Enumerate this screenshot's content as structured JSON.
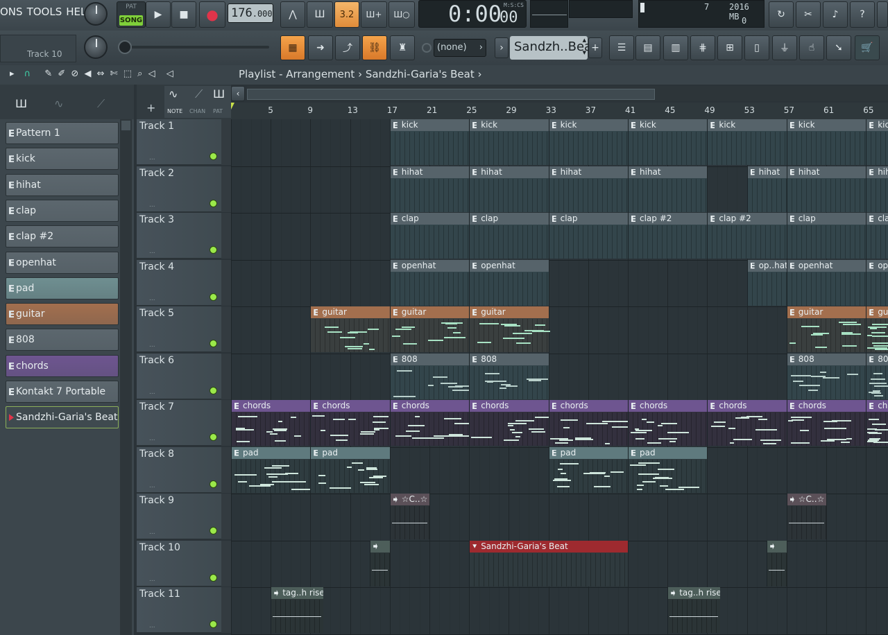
{
  "menu": [
    "ONS",
    "TOOLS",
    "HELP"
  ],
  "hint": {
    "text": "Track 10"
  },
  "transport": {
    "pat_label": "PAT",
    "song_label": "SONG",
    "tempo": "176",
    "tempo_frac": ".000"
  },
  "time": {
    "value": "0:00",
    "small": "00",
    "unit": "M:S:CS"
  },
  "monitor": {
    "poly": "7",
    "mem": "2016 MB",
    "cpu": "0"
  },
  "toolbar": {
    "pattern_selector": "(none)",
    "pattern_name": "Sandzh..Beat",
    "pattern_add": "+",
    "pattern_nav": "›",
    "stepper_up": "▲",
    "stepper_down": "▼",
    "time_display_button": "3.2",
    "add_pattern_button": "Ш+",
    "loop_button": "Ш○"
  },
  "breadcrumb": {
    "text": "Playlist - Arrangement",
    "sep": "›",
    "project": "Sandzhi-Garia's Beat",
    "sep2": "›"
  },
  "picker_tabs": {
    "note": "NOTE",
    "chan": "CHAN",
    "pat": "PAT"
  },
  "picker": [
    {
      "label": "Pattern 1",
      "color": "#5c676e"
    },
    {
      "label": "kick",
      "color": "#5c676e"
    },
    {
      "label": "hihat",
      "color": "#5c676e"
    },
    {
      "label": "clap",
      "color": "#5c676e"
    },
    {
      "label": "clap #2",
      "color": "#5c676e"
    },
    {
      "label": "openhat",
      "color": "#5c676e"
    },
    {
      "label": "pad",
      "color": "#6f8f91"
    },
    {
      "label": "guitar",
      "color": "#a36f4e"
    },
    {
      "label": "808",
      "color": "#5c676e"
    },
    {
      "label": "chords",
      "color": "#6e5590"
    },
    {
      "label": "Kontakt 7 Portable",
      "color": "#5c676e"
    },
    {
      "label": "Sandzhi-Garia's Beat",
      "color": "#3f4a4f",
      "selected": true
    }
  ],
  "tracks": [
    "Track 1",
    "Track 2",
    "Track 3",
    "Track 4",
    "Track 5",
    "Track 6",
    "Track 7",
    "Track 8",
    "Track 9",
    "Track 10",
    "Track 11"
  ],
  "track_dots": "...",
  "ruler": [
    "5",
    "9",
    "13",
    "17",
    "21",
    "25",
    "29",
    "33",
    "37",
    "41",
    "45",
    "49",
    "53",
    "57",
    "61",
    "65"
  ],
  "clips": [
    {
      "track": 0,
      "bar": 17,
      "len": 8,
      "label": "kick",
      "kind": "pattern"
    },
    {
      "track": 0,
      "bar": 25,
      "len": 8,
      "label": "kick",
      "kind": "pattern"
    },
    {
      "track": 0,
      "bar": 33,
      "len": 8,
      "label": "kick",
      "kind": "pattern"
    },
    {
      "track": 0,
      "bar": 41,
      "len": 8,
      "label": "kick",
      "kind": "pattern"
    },
    {
      "track": 0,
      "bar": 49,
      "len": 8,
      "label": "kick",
      "kind": "pattern"
    },
    {
      "track": 0,
      "bar": 57,
      "len": 8,
      "label": "kick",
      "kind": "pattern"
    },
    {
      "track": 0,
      "bar": 65,
      "len": 8,
      "label": "kic",
      "kind": "pattern"
    },
    {
      "track": 1,
      "bar": 17,
      "len": 8,
      "label": "hihat",
      "kind": "pattern"
    },
    {
      "track": 1,
      "bar": 25,
      "len": 8,
      "label": "hihat",
      "kind": "pattern"
    },
    {
      "track": 1,
      "bar": 33,
      "len": 8,
      "label": "hihat",
      "kind": "pattern"
    },
    {
      "track": 1,
      "bar": 41,
      "len": 8,
      "label": "hihat",
      "kind": "pattern"
    },
    {
      "track": 1,
      "bar": 53,
      "len": 4,
      "label": "hihat",
      "kind": "pattern"
    },
    {
      "track": 1,
      "bar": 57,
      "len": 8,
      "label": "hihat",
      "kind": "pattern"
    },
    {
      "track": 1,
      "bar": 65,
      "len": 8,
      "label": "hih",
      "kind": "pattern"
    },
    {
      "track": 2,
      "bar": 17,
      "len": 8,
      "label": "clap",
      "kind": "pattern"
    },
    {
      "track": 2,
      "bar": 25,
      "len": 8,
      "label": "clap",
      "kind": "pattern"
    },
    {
      "track": 2,
      "bar": 33,
      "len": 8,
      "label": "clap",
      "kind": "pattern"
    },
    {
      "track": 2,
      "bar": 41,
      "len": 8,
      "label": "clap #2",
      "kind": "pattern"
    },
    {
      "track": 2,
      "bar": 49,
      "len": 8,
      "label": "clap #2",
      "kind": "pattern"
    },
    {
      "track": 2,
      "bar": 57,
      "len": 8,
      "label": "clap",
      "kind": "pattern"
    },
    {
      "track": 2,
      "bar": 65,
      "len": 8,
      "label": "cla",
      "kind": "pattern"
    },
    {
      "track": 3,
      "bar": 17,
      "len": 8,
      "label": "openhat",
      "kind": "pattern"
    },
    {
      "track": 3,
      "bar": 25,
      "len": 8,
      "label": "openhat",
      "kind": "pattern"
    },
    {
      "track": 3,
      "bar": 53,
      "len": 4,
      "label": "op..hat",
      "kind": "pattern"
    },
    {
      "track": 3,
      "bar": 57,
      "len": 8,
      "label": "openhat",
      "kind": "pattern"
    },
    {
      "track": 3,
      "bar": 65,
      "len": 8,
      "label": "ope",
      "kind": "pattern"
    },
    {
      "track": 4,
      "bar": 9,
      "len": 8,
      "label": "guitar",
      "kind": "guitar"
    },
    {
      "track": 4,
      "bar": 17,
      "len": 8,
      "label": "guitar",
      "kind": "guitar"
    },
    {
      "track": 4,
      "bar": 25,
      "len": 8,
      "label": "guitar",
      "kind": "guitar"
    },
    {
      "track": 4,
      "bar": 57,
      "len": 8,
      "label": "guitar",
      "kind": "guitar"
    },
    {
      "track": 4,
      "bar": 65,
      "len": 8,
      "label": "gui",
      "kind": "guitar"
    },
    {
      "track": 5,
      "bar": 17,
      "len": 8,
      "label": "808",
      "kind": "pattern"
    },
    {
      "track": 5,
      "bar": 25,
      "len": 8,
      "label": "808",
      "kind": "pattern"
    },
    {
      "track": 5,
      "bar": 57,
      "len": 8,
      "label": "808",
      "kind": "pattern"
    },
    {
      "track": 5,
      "bar": 65,
      "len": 8,
      "label": "808",
      "kind": "pattern"
    },
    {
      "track": 6,
      "bar": 1,
      "len": 8,
      "label": "chords",
      "kind": "chords"
    },
    {
      "track": 6,
      "bar": 9,
      "len": 8,
      "label": "chords",
      "kind": "chords"
    },
    {
      "track": 6,
      "bar": 17,
      "len": 8,
      "label": "chords",
      "kind": "chords"
    },
    {
      "track": 6,
      "bar": 25,
      "len": 8,
      "label": "chords",
      "kind": "chords"
    },
    {
      "track": 6,
      "bar": 33,
      "len": 8,
      "label": "chords",
      "kind": "chords"
    },
    {
      "track": 6,
      "bar": 41,
      "len": 8,
      "label": "chords",
      "kind": "chords"
    },
    {
      "track": 6,
      "bar": 49,
      "len": 8,
      "label": "chords",
      "kind": "chords"
    },
    {
      "track": 6,
      "bar": 57,
      "len": 8,
      "label": "chords",
      "kind": "chords"
    },
    {
      "track": 6,
      "bar": 65,
      "len": 8,
      "label": "cho",
      "kind": "chords"
    },
    {
      "track": 7,
      "bar": 1,
      "len": 8,
      "label": "pad",
      "kind": "pad"
    },
    {
      "track": 7,
      "bar": 9,
      "len": 8,
      "label": "pad",
      "kind": "pad"
    },
    {
      "track": 7,
      "bar": 33,
      "len": 8,
      "label": "pad",
      "kind": "pad"
    },
    {
      "track": 7,
      "bar": 41,
      "len": 8,
      "label": "pad",
      "kind": "pad"
    },
    {
      "track": 8,
      "bar": 17,
      "len": 4,
      "label": "☆C..☆",
      "kind": "auto"
    },
    {
      "track": 8,
      "bar": 57,
      "len": 4,
      "label": "☆C..☆",
      "kind": "auto"
    },
    {
      "track": 9,
      "bar": 15,
      "len": 2,
      "label": "",
      "kind": "aud"
    },
    {
      "track": 9,
      "bar": 25,
      "len": 16,
      "label": "Sandzhi-Garia's Beat",
      "kind": "red"
    },
    {
      "track": 9,
      "bar": 55,
      "len": 2,
      "label": "",
      "kind": "aud"
    },
    {
      "track": 10,
      "bar": 5,
      "len": 5.3,
      "label": "tag..h rise",
      "kind": "aud"
    },
    {
      "track": 10,
      "bar": 45,
      "len": 5.3,
      "label": "tag..h rise",
      "kind": "aud"
    }
  ]
}
